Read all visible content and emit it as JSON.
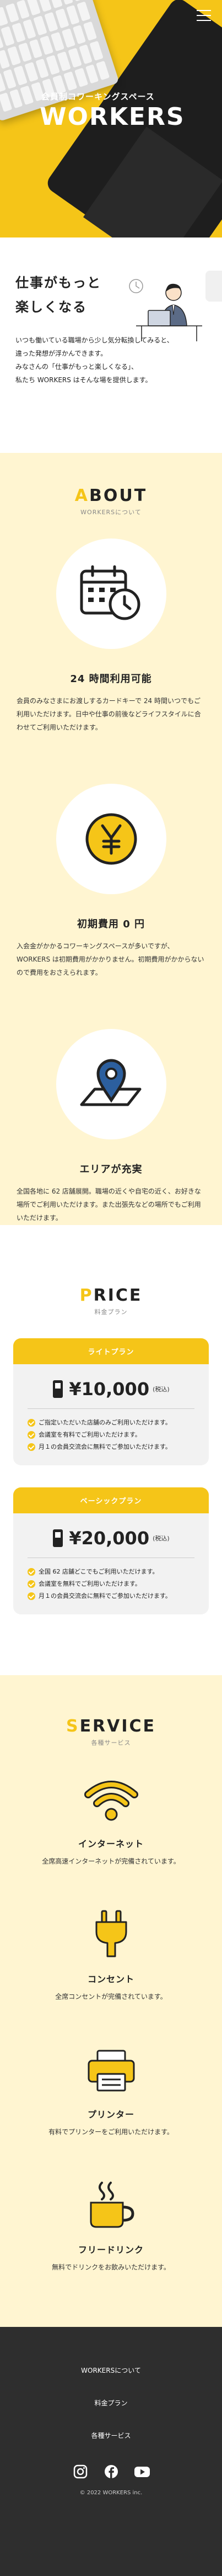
{
  "hero": {
    "tagline": "会員制コワーキングスペース",
    "brand": "WORKERS"
  },
  "intro": {
    "catch_line1": "仕事がもっと",
    "catch_line2": "楽しくなる",
    "desc_line1": "いつも働いている職場から少し気分転換してみると、",
    "desc_line2": "違った発想が浮かんできます。",
    "desc_line3": "みなさんの「仕事がもっと楽しくなる」、",
    "desc_line4": "私たち WORKERS はそんな場を提供します。"
  },
  "about": {
    "title_first": "A",
    "title_rest": "BOUT",
    "subtitle": "WORKERSについて",
    "features": [
      {
        "title": "24 時間利用可能",
        "text": "会員のみなさまにお渡しするカードキーで 24 時間いつでもご利用いただけます。日中や仕事の前後などライフスタイルに合わせてご利用いただけます。"
      },
      {
        "title": "初期費用 0 円",
        "text": "入会金がかかるコワーキングスペースが多いですが、WORKERS は初期費用がかかりません。初期費用がかからないので費用をおさえられます。"
      },
      {
        "title": "エリアが充実",
        "text": "全国各地に 62 店舗展開。職場の近くや自宅の近く、お好きな場所でご利用いただけます。また出張先などの場所でもご利用いただけます。"
      }
    ]
  },
  "price": {
    "title_first": "P",
    "title_rest": "RICE",
    "subtitle": "料金プラン",
    "plans": [
      {
        "name": "ライトプラン",
        "amount": "¥10,000",
        "tax": "(税込)",
        "items": [
          "ご指定いただいた店舗のみご利用いただけます。",
          "会議室を有料でご利用いただけます。",
          "月１の会員交流会に無料でご参加いただけます。"
        ]
      },
      {
        "name": "ベーシックプラン",
        "amount": "¥20,000",
        "tax": "(税込)",
        "items": [
          "全国 62 店舗どこでもご利用いただけます。",
          "会議室を無料でご利用いただけます。",
          "月１の会員交流会に無料でご参加いただけます。"
        ]
      }
    ]
  },
  "service": {
    "title_first": "S",
    "title_rest": "ERVICE",
    "subtitle": "各種サービス",
    "items": [
      {
        "title": "インターネット",
        "text": "全席高速インターネットが完備されています。"
      },
      {
        "title": "コンセント",
        "text": "全席コンセントが完備されています。"
      },
      {
        "title": "プリンター",
        "text": "有料でプリンターをご利用いただけます。"
      },
      {
        "title": "フリードリンク",
        "text": "無料でドリンクをお飲みいただけます。"
      }
    ]
  },
  "footer": {
    "links": [
      "WORKERSについて",
      "料金プラン",
      "各種サービス"
    ],
    "copyright": "© 2022 WORKERS inc."
  },
  "colors": {
    "accent": "#f5c518",
    "cream": "#fff5d1",
    "dark": "#2e2e2e"
  }
}
